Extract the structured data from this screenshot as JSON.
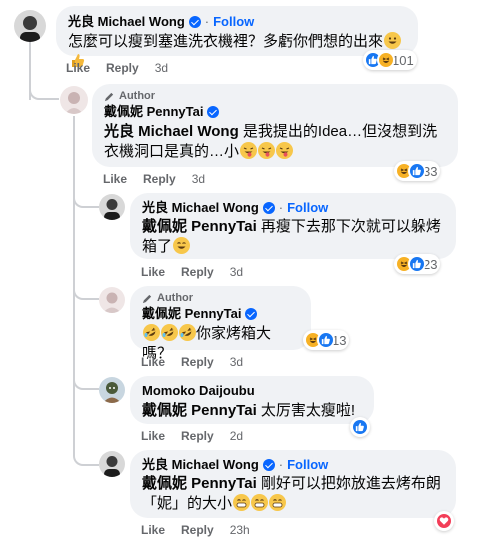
{
  "comments": [
    {
      "name": "光良 Michael Wong",
      "follow": "Follow",
      "text": "怎麼可以瘦到塞進洗衣機裡？多虧你們想的出來",
      "like": "Like",
      "reply": "Reply",
      "time": "3d",
      "reaction_count": "101",
      "reactions": [
        "like-icon",
        "haha-icon"
      ],
      "emoji": [
        "grinning-emoji",
        "thumbs-up-emoji"
      ]
    },
    {
      "author_tag": "Author",
      "name": "戴佩妮 PennyTai",
      "mention": "光良 Michael Wong",
      "text_line1": " 是我提出的Idea…但沒想到洗",
      "text_line2": "衣機洞口是真的…小",
      "like": "Like",
      "reply": "Reply",
      "time": "3d",
      "reaction_count": "33",
      "reactions": [
        "haha-icon",
        "like-icon"
      ],
      "emoji": [
        "tongue-emoji",
        "tongue-emoji",
        "tongue-emoji"
      ]
    },
    {
      "name": "光良 Michael Wong",
      "follow": "Follow",
      "mention": "戴佩妮 PennyTai",
      "text_line1": " 再瘦下去那下次就可以躲烤",
      "text_line2": "箱了",
      "like": "Like",
      "reply": "Reply",
      "time": "3d",
      "reaction_count": "23",
      "reactions": [
        "haha-icon",
        "like-icon"
      ],
      "emoji": [
        "grinning-emoji"
      ]
    },
    {
      "author_tag": "Author",
      "name": "戴佩妮 PennyTai",
      "text": "你家烤箱大嗎？",
      "like": "Like",
      "reply": "Reply",
      "time": "3d",
      "reaction_count": "13",
      "reactions": [
        "haha-icon",
        "like-icon"
      ],
      "emoji": [
        "rofl-emoji",
        "rofl-emoji",
        "rofl-emoji"
      ]
    },
    {
      "name": "Momoko Daijoubu",
      "mention": "戴佩妮 PennyTai",
      "text": " 太厉害太瘦啦!",
      "like": "Like",
      "reply": "Reply",
      "time": "2d",
      "reactions": [
        "like-icon"
      ]
    },
    {
      "name": "光良 Michael Wong",
      "follow": "Follow",
      "mention": "戴佩妮 PennyTai",
      "text_line1": " 剛好可以把妳放進去烤布朗",
      "text_line2": "「妮」的大小",
      "like": "Like",
      "reply": "Reply",
      "time": "23h",
      "reactions": [
        "love-icon"
      ],
      "emoji": [
        "grin-emoji",
        "grin-emoji",
        "grin-emoji"
      ]
    }
  ],
  "colors": {
    "bubble": "#f0f2f5",
    "link": "#0866ff",
    "meta": "#65676b",
    "line": "#ced0d4"
  }
}
